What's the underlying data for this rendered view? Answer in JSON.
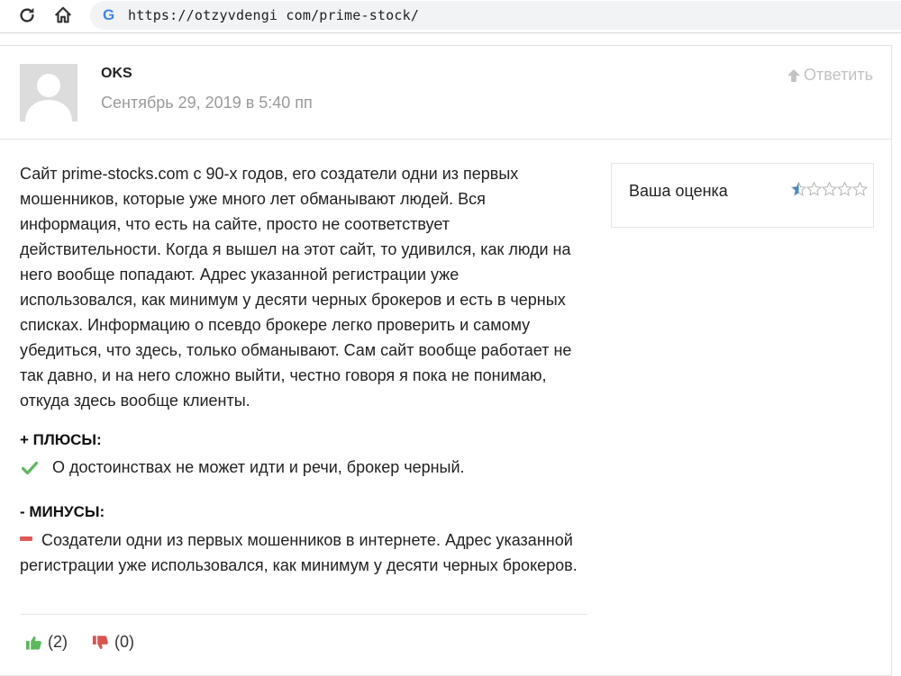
{
  "browser": {
    "url": "https://otzyvdengi com/prime-stock/",
    "reload_icon": "reload-icon",
    "home_icon": "home-icon",
    "site_icon": "google-g-icon",
    "site_icon_text": "G"
  },
  "comment": {
    "author": "OKS",
    "date": "Сентябрь 29, 2019 в 5:40 пп",
    "reply_label": "Ответить",
    "body": "Сайт prime-stocks.com с 90-х годов, его создатели одни из первых мошенников, которые уже много лет обманывают людей. Вся информация, что есть на сайте, просто не соответствует действительности. Когда я вышел на этот сайт, то удивился, как люди на него вообще попадают. Адрес указанной регистрации уже использовался, как минимум у десяти черных брокеров и есть в черных списках. Информацию о псевдо брокере легко проверить и самому убедиться, что здесь, только обманывают. Сам сайт вообще работает не так давно, и на него сложно выйти, честно говоря я пока не понимаю, откуда здесь вообще клиенты.",
    "rating": {
      "label": "Ваша оценка",
      "value": 1,
      "max": 5
    },
    "pros": {
      "heading": "+ ПЛЮСЫ:",
      "item": "О достоинствах не может идти и речи, брокер черный."
    },
    "cons": {
      "heading": "- МИНУСЫ:",
      "item": "Создатели одни из первых мошенников в интернете. Адрес указанной регистрации уже использовался, как минимум у десяти черных брокеров."
    },
    "votes": {
      "up": "(2)",
      "down": "(0)"
    }
  },
  "colors": {
    "check": "#5cb85c",
    "minus": "#e05a5a",
    "thumb_up": "#5cb85c",
    "thumb_down": "#d9534f",
    "star_filled": "#4a86c5",
    "star_empty": "#b5b5b5",
    "muted_text": "#9a9a9a"
  }
}
